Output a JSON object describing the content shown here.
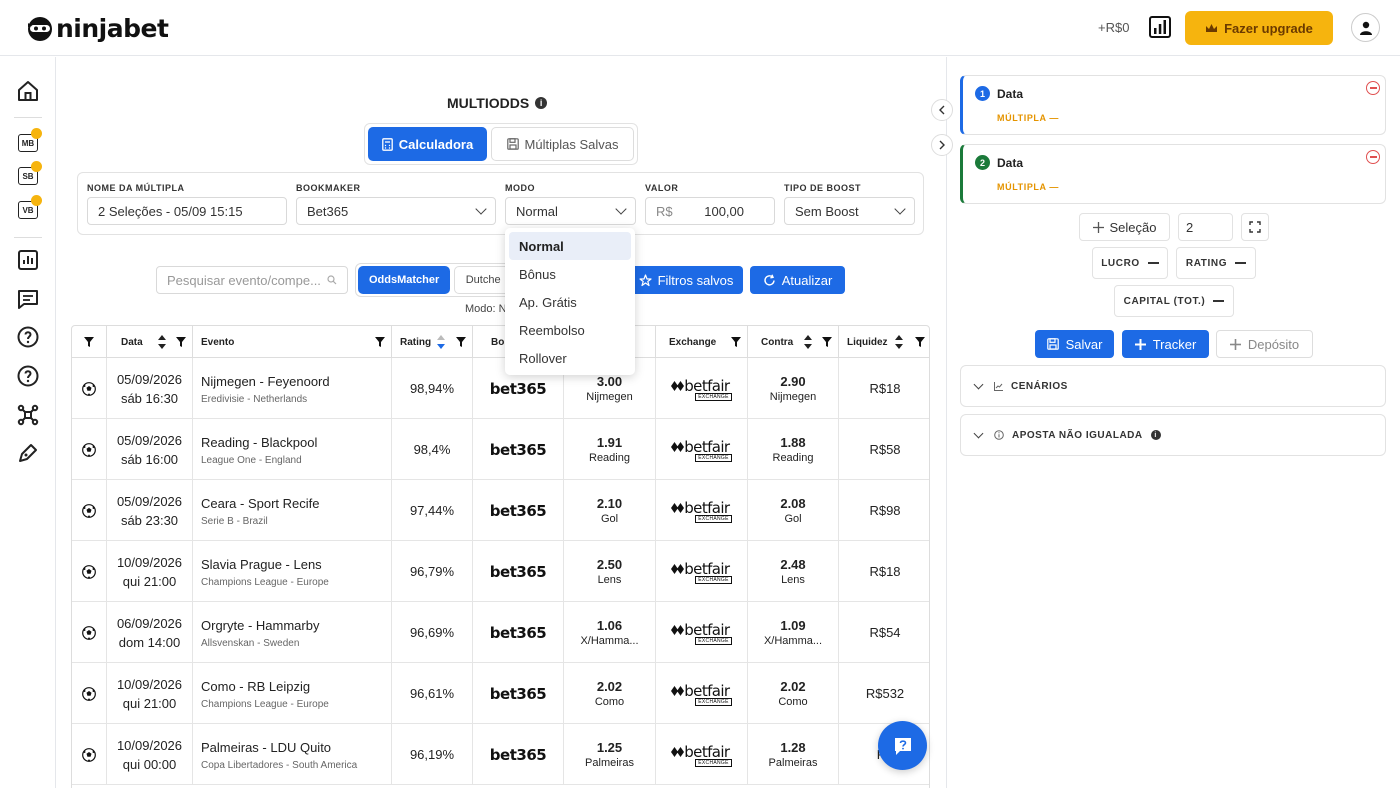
{
  "header": {
    "logo_text": "ninjabet",
    "balance": "+R$0",
    "upgrade_label": "Fazer upgrade"
  },
  "sidebar": {
    "badges": [
      "MB",
      "SB",
      "VB"
    ]
  },
  "page": {
    "title": "MULTIODDS",
    "tabs": [
      {
        "label": "Calculadora",
        "active": true
      },
      {
        "label": "Múltiplas Salvas",
        "active": false
      }
    ]
  },
  "form": {
    "nome_label": "NOME DA MÚLTIPLA",
    "nome_value": "2 Seleções - 05/09 15:15",
    "bookmaker_label": "BOOKMAKER",
    "bookmaker_value": "Bet365",
    "modo_label": "MODO",
    "modo_value": "Normal",
    "valor_label": "VALOR",
    "valor_prefix": "R$",
    "valor_value": "100,00",
    "boost_label": "TIPO DE BOOST",
    "boost_value": "Sem Boost"
  },
  "modo_options": [
    "Normal",
    "Bônus",
    "Ap. Grátis",
    "Reembolso",
    "Rollover"
  ],
  "toolbar": {
    "search_placeholder": "Pesquisar evento/compe...",
    "seg_active": "OddsMatcher",
    "seg_inactive": "Dutche",
    "saved_filters": "Filtros salvos",
    "refresh": "Atualizar",
    "modo_text": "Modo: N"
  },
  "table": {
    "headers": [
      "Data",
      "Evento",
      "Rating",
      "Bo",
      "Exchange",
      "Contra",
      "Liquidez"
    ],
    "rows": [
      {
        "date": "05/09/2026",
        "day": "sáb 16:30",
        "event": "Nijmegen - Feyenoord",
        "league": "Eredivisie - Netherlands",
        "rating": "98,94%",
        "back": "3.00",
        "back_sel": "Nijmegen",
        "lay": "2.90",
        "lay_sel": "Nijmegen",
        "liq": "R$18"
      },
      {
        "date": "05/09/2026",
        "day": "sáb 16:00",
        "event": "Reading - Blackpool",
        "league": "League One - England",
        "rating": "98,4%",
        "back": "1.91",
        "back_sel": "Reading",
        "lay": "1.88",
        "lay_sel": "Reading",
        "liq": "R$58"
      },
      {
        "date": "05/09/2026",
        "day": "sáb 23:30",
        "event": "Ceara - Sport Recife",
        "league": "Serie B - Brazil",
        "rating": "97,44%",
        "back": "2.10",
        "back_sel": "Gol",
        "lay": "2.08",
        "lay_sel": "Gol",
        "liq": "R$98"
      },
      {
        "date": "10/09/2026",
        "day": "qui 21:00",
        "event": "Slavia Prague - Lens",
        "league": "Champions League - Europe",
        "rating": "96,79%",
        "back": "2.50",
        "back_sel": "Lens",
        "lay": "2.48",
        "lay_sel": "Lens",
        "liq": "R$18"
      },
      {
        "date": "06/09/2026",
        "day": "dom 14:00",
        "event": "Orgryte - Hammarby",
        "league": "Allsvenskan - Sweden",
        "rating": "96,69%",
        "back": "1.06",
        "back_sel": "X/Hamma...",
        "lay": "1.09",
        "lay_sel": "X/Hamma...",
        "liq": "R$54"
      },
      {
        "date": "10/09/2026",
        "day": "qui 21:00",
        "event": "Como - RB Leipzig",
        "league": "Champions League - Europe",
        "rating": "96,61%",
        "back": "2.02",
        "back_sel": "Como",
        "lay": "2.02",
        "lay_sel": "Como",
        "liq": "R$532"
      },
      {
        "date": "10/09/2026",
        "day": "qui 00:00",
        "event": "Palmeiras - LDU Quito",
        "league": "Copa Libertadores - South America",
        "rating": "96,19%",
        "back": "1.25",
        "back_sel": "Palmeiras",
        "lay": "1.28",
        "lay_sel": "Palmeiras",
        "liq": "R$"
      }
    ],
    "bookmaker_logo": "bet365",
    "exchange_logo": "betfair",
    "exchange_sub": "EXCHANGE"
  },
  "right": {
    "legs": [
      {
        "num": "1",
        "title": "Data",
        "sub": "MÚLTIPLA —"
      },
      {
        "num": "2",
        "title": "Data",
        "sub": "MÚLTIPLA —"
      }
    ],
    "add_selection": "Seleção",
    "count": "2",
    "lucro_label": "LUCRO",
    "rating_label": "RATING",
    "capital_label": "CAPITAL (TOT.)",
    "salvar": "Salvar",
    "tracker": "Tracker",
    "deposito": "Depósito",
    "cenarios": "CENÁRIOS",
    "aposta": "APOSTA NÃO IGUALADA"
  },
  "colors": {
    "primary": "#1d6ae5",
    "upgrade": "#f6b40e",
    "accent_orange": "#e59400",
    "leg2": "#1b7a3a"
  }
}
